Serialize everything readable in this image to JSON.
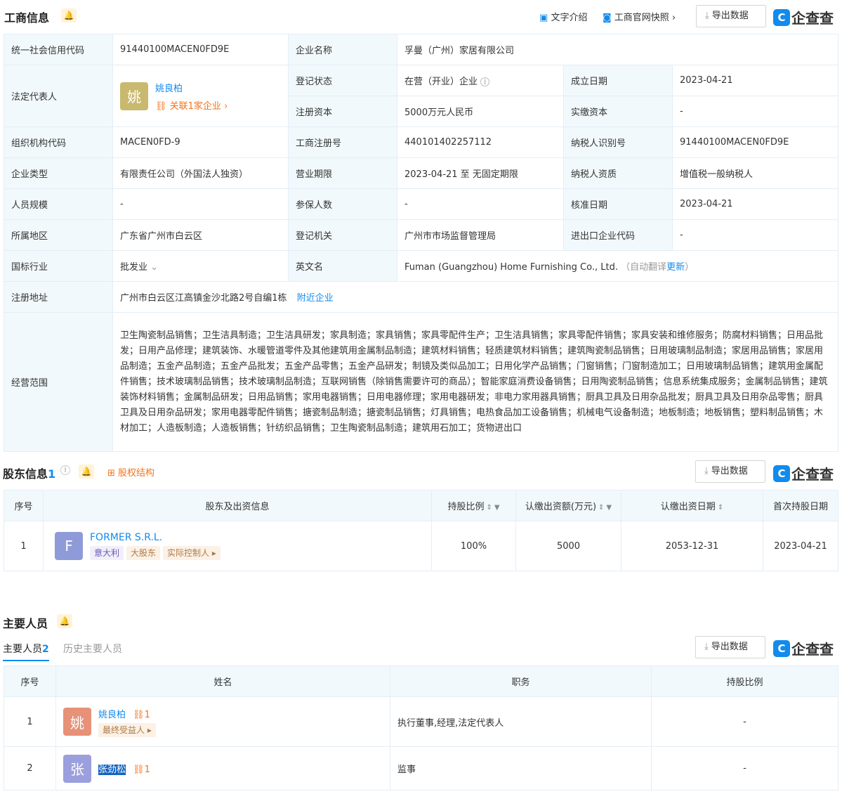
{
  "biz": {
    "title": "工商信息",
    "toolbar": {
      "text_intro": "文字介绍",
      "snapshot": "工商官网快照",
      "export": "导出数据"
    },
    "logo": "企查查",
    "rows": {
      "credit_code_label": "统一社会信用代码",
      "credit_code": "91440100MACEN0FD9E",
      "company_name_label": "企业名称",
      "company_name": "孚曼（广州）家居有限公司",
      "legal_rep_label": "法定代表人",
      "legal_rep_avatar": "姚",
      "legal_rep_name": "姚良柏",
      "legal_rep_related": "关联1家企业",
      "reg_status_label": "登记状态",
      "reg_status": "在营（开业）企业",
      "est_date_label": "成立日期",
      "est_date": "2023-04-21",
      "reg_capital_label": "注册资本",
      "reg_capital": "5000万元人民币",
      "paid_capital_label": "实缴资本",
      "paid_capital": "-",
      "org_code_label": "组织机构代码",
      "org_code": "MACEN0FD-9",
      "reg_no_label": "工商注册号",
      "reg_no": "440101402257112",
      "taxpayer_id_label": "纳税人识别号",
      "taxpayer_id": "91440100MACEN0FD9E",
      "company_type_label": "企业类型",
      "company_type": "有限责任公司（外国法人独资）",
      "biz_term_label": "营业期限",
      "biz_term": "2023-04-21 至 无固定期限",
      "taxpayer_qual_label": "纳税人资质",
      "taxpayer_qual": "增值税一般纳税人",
      "staff_size_label": "人员规模",
      "staff_size": "-",
      "insured_label": "参保人数",
      "insured": "-",
      "approve_date_label": "核准日期",
      "approve_date": "2023-04-21",
      "region_label": "所属地区",
      "region": "广东省广州市白云区",
      "reg_authority_label": "登记机关",
      "reg_authority": "广州市市场监督管理局",
      "import_export_label": "进出口企业代码",
      "import_export": "-",
      "industry_label": "国标行业",
      "industry": "批发业",
      "english_name_label": "英文名",
      "english_name": "Fuman (Guangzhou) Home Furnishing Co., Ltd.",
      "auto_translate": "（自动翻译",
      "update": "更新",
      "close_paren": "）",
      "address_label": "注册地址",
      "address": "广州市白云区江高镇金沙北路2号自编1栋",
      "nearby": "附近企业",
      "scope_label": "经营范围",
      "scope": "卫生陶瓷制品销售；卫生洁具制造；卫生洁具研发；家具制造；家具销售；家具零配件生产；卫生洁具销售；家具零配件销售；家具安装和维修服务；防腐材料销售；日用品批发；日用产品修理；建筑装饰、水暖管道零件及其他建筑用金属制品制造；建筑材料销售；轻质建筑材料销售；建筑陶瓷制品销售；日用玻璃制品制造；家居用品销售；家居用品制造；五金产品制造；五金产品批发；五金产品零售；五金产品研发；制镜及类似品加工；日用化学产品销售；门窗销售；门窗制造加工；日用玻璃制品销售；建筑用金属配件销售；技术玻璃制品销售；技术玻璃制品制造；互联网销售（除销售需要许可的商品）；智能家庭消费设备销售；日用陶瓷制品销售；信息系统集成服务；金属制品销售；建筑装饰材料销售；金属制品研发；日用品销售；家用电器销售；日用电器修理；家用电器研发；非电力家用器具销售；厨具卫具及日用杂品批发；厨具卫具及日用杂品零售；厨具卫具及日用杂品研发；家用电器零配件销售；搪瓷制品制造；搪瓷制品销售；灯具销售；电热食品加工设备销售；机械电气设备制造；地板制造；地板销售；塑料制品销售；木材加工；人造板制造；人造板销售；针纺织品销售；卫生陶瓷制品制造；建筑用石加工；货物进出口"
    }
  },
  "shareholders": {
    "title": "股东信息",
    "count": "1",
    "equity": "股权结构",
    "export": "导出数据",
    "logo": "企查查",
    "headers": {
      "no": "序号",
      "info": "股东及出资信息",
      "ratio": "持股比例",
      "subscribed": "认缴出资额(万元)",
      "sub_date": "认缴出资日期",
      "first_date": "首次持股日期"
    },
    "rows": [
      {
        "no": "1",
        "avatar": "F",
        "name": "FORMER S.R.L.",
        "tags": [
          "意大利",
          "大股东",
          "实际控制人"
        ],
        "ratio": "100%",
        "subscribed": "5000",
        "sub_date": "2053-12-31",
        "first_date": "2023-04-21"
      }
    ]
  },
  "personnel": {
    "title": "主要人员",
    "tab_active": "主要人员",
    "tab_active_count": "2",
    "tab_history": "历史主要人员",
    "export": "导出数据",
    "logo": "企查查",
    "headers": {
      "no": "序号",
      "name": "姓名",
      "position": "职务",
      "ratio": "持股比例"
    },
    "rows": [
      {
        "no": "1",
        "avatar": "姚",
        "name": "姚良柏",
        "link_count": "1",
        "tag": "最终受益人",
        "position": "执行董事,经理,法定代表人",
        "ratio": "-"
      },
      {
        "no": "2",
        "avatar": "张",
        "name": "张劲松",
        "link_count": "1",
        "tag": "",
        "position": "监事",
        "ratio": "-"
      }
    ]
  },
  "colors": {
    "accent": "#128bed",
    "orange": "#f5721b",
    "label_bg": "#f2f9fc",
    "avatar_yao1": "#c8b96e",
    "avatar_former": "#8f9bd8",
    "avatar_yao2": "#e69178",
    "avatar_zhang": "#9b9fdd"
  }
}
